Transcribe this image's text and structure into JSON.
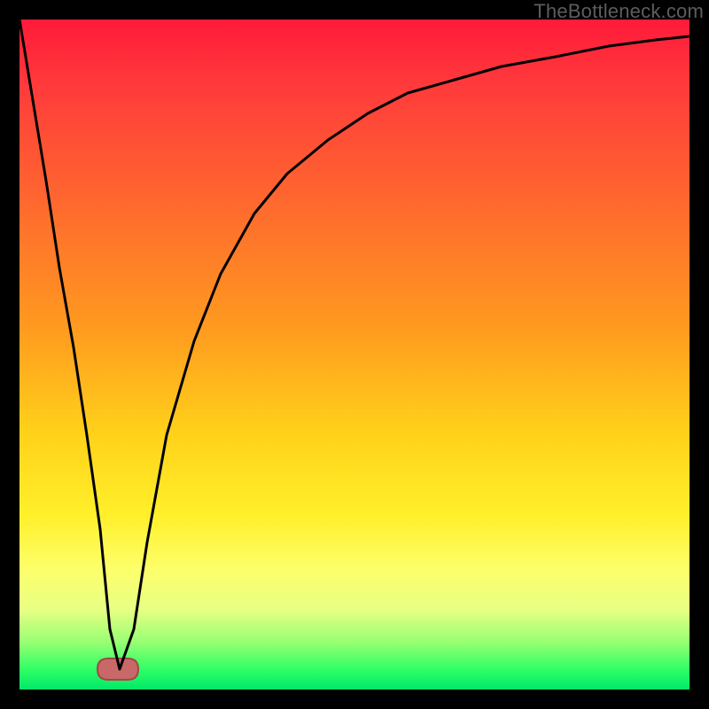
{
  "watermark": "TheBottleneck.com",
  "colors": {
    "frame": "#000000",
    "gradient_stops": [
      "#ff1a3a",
      "#ff3b3b",
      "#ff6a2e",
      "#ff9a1f",
      "#ffd21a",
      "#fff02a",
      "#fdff6a",
      "#e8ff84",
      "#96ff73",
      "#2fff65",
      "#00e868"
    ],
    "curve_stroke": "#000000",
    "blob_fill": "#c86868",
    "blob_stroke": "#a04848"
  },
  "chart_data": {
    "type": "line",
    "title": "",
    "xlabel": "",
    "ylabel": "",
    "xlim": [
      0,
      100
    ],
    "ylim": [
      0,
      100
    ],
    "grid": false,
    "legend": false,
    "annotations": [],
    "series": [
      {
        "name": "bottleneck-curve",
        "x": [
          0,
          2,
          4,
          6,
          8,
          10,
          12,
          13.5,
          15,
          17,
          19,
          22,
          26,
          30,
          35,
          40,
          46,
          52,
          58,
          65,
          72,
          80,
          88,
          95,
          100
        ],
        "y": [
          100,
          88,
          76,
          63,
          51,
          38,
          24,
          9,
          3,
          9,
          22,
          38,
          52,
          62,
          71,
          77,
          82,
          86,
          89,
          91,
          93,
          94.5,
          96,
          97,
          97.5
        ]
      }
    ],
    "marker": {
      "name": "optimal-region-blob",
      "x_range": [
        11.5,
        16.5
      ],
      "y": 3.5
    }
  }
}
